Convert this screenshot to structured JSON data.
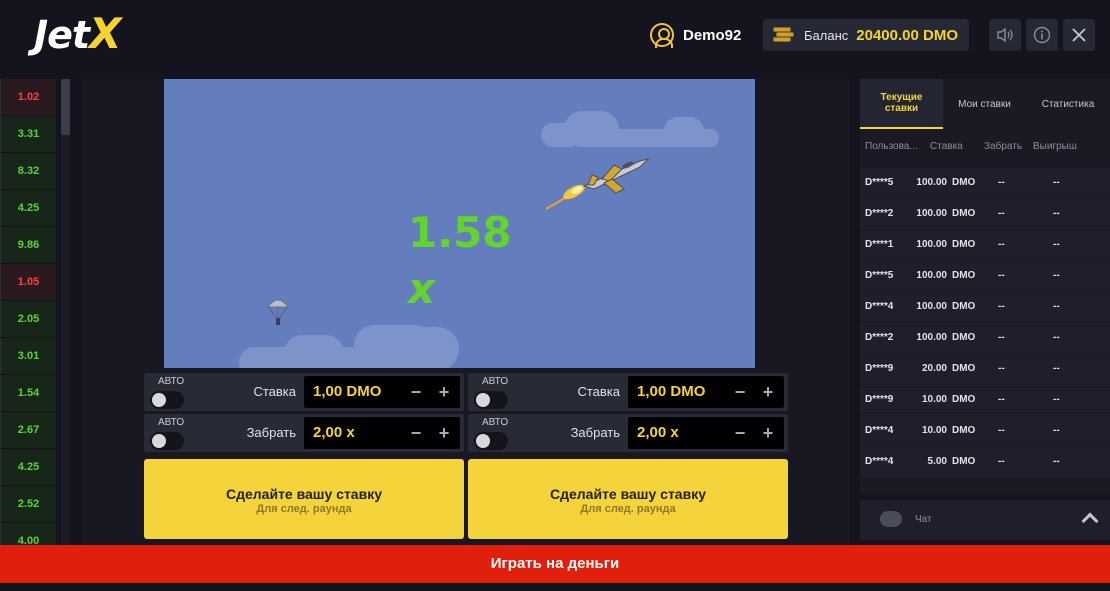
{
  "header": {
    "logo_jet": "Jet",
    "logo_x": "X",
    "username": "Demo92",
    "balance_label": "Баланс",
    "balance_value": "20400.00 DMO"
  },
  "history": [
    {
      "value": "1.02",
      "level": "lo"
    },
    {
      "value": "3.31",
      "level": "hi"
    },
    {
      "value": "8.32",
      "level": "hi"
    },
    {
      "value": "4.25",
      "level": "hi"
    },
    {
      "value": "9.86",
      "level": "hi"
    },
    {
      "value": "1.05",
      "level": "lo"
    },
    {
      "value": "2.05",
      "level": "hi"
    },
    {
      "value": "3.01",
      "level": "hi"
    },
    {
      "value": "1.54",
      "level": "hi"
    },
    {
      "value": "2.67",
      "level": "hi"
    },
    {
      "value": "4.25",
      "level": "hi"
    },
    {
      "value": "2.52",
      "level": "hi"
    },
    {
      "value": "4.00",
      "level": "hi"
    }
  ],
  "game": {
    "multiplier": "1.58",
    "multiplier_suffix": "x"
  },
  "panels": [
    {
      "auto_label_1": "АВТО",
      "stake_label": "Ставка",
      "stake_value": "1,00 DMO",
      "auto_label_2": "АВТО",
      "cashout_label": "Забрать",
      "cashout_value": "2,00 x",
      "button_main": "Сделайте вашу ставку",
      "button_sub": "Для след. раунда"
    },
    {
      "auto_label_1": "АВТО",
      "stake_label": "Ставка",
      "stake_value": "1,00 DMO",
      "auto_label_2": "АВТО",
      "cashout_label": "Забрать",
      "cashout_value": "2,00 x",
      "button_main": "Сделайте вашу ставку",
      "button_sub": "Для след. раунда"
    }
  ],
  "stepper": {
    "minus": "−",
    "plus": "+"
  },
  "right_panel": {
    "tabs": [
      "Текущие ставки",
      "Мои ставки",
      "Статистика"
    ],
    "columns": [
      "Пользова...",
      "Ставка",
      "Забрать",
      "Выигрыш"
    ],
    "rows": [
      {
        "user": "D****5",
        "stake": "100.00",
        "cur": "DMO",
        "cashout": "--",
        "win": "--"
      },
      {
        "user": "D****2",
        "stake": "100.00",
        "cur": "DMO",
        "cashout": "--",
        "win": "--"
      },
      {
        "user": "D****1",
        "stake": "100.00",
        "cur": "DMO",
        "cashout": "--",
        "win": "--"
      },
      {
        "user": "D****5",
        "stake": "100.00",
        "cur": "DMO",
        "cashout": "--",
        "win": "--"
      },
      {
        "user": "D****4",
        "stake": "100.00",
        "cur": "DMO",
        "cashout": "--",
        "win": "--"
      },
      {
        "user": "D****2",
        "stake": "100.00",
        "cur": "DMO",
        "cashout": "--",
        "win": "--"
      },
      {
        "user": "D****9",
        "stake": "20.00",
        "cur": "DMO",
        "cashout": "--",
        "win": "--"
      },
      {
        "user": "D****9",
        "stake": "10.00",
        "cur": "DMO",
        "cashout": "--",
        "win": "--"
      },
      {
        "user": "D****4",
        "stake": "10.00",
        "cur": "DMO",
        "cashout": "--",
        "win": "--"
      },
      {
        "user": "D****4",
        "stake": "5.00",
        "cur": "DMO",
        "cashout": "--",
        "win": "--"
      }
    ],
    "chat_label": "Чат"
  },
  "play_button": "Играть на деньги",
  "icons": {
    "sound": "speaker-icon",
    "info": "info-icon",
    "close": "close-icon"
  },
  "colors": {
    "accent": "#f5d52c",
    "multiplier": "#63d32e",
    "loss": "#ff3e3e",
    "win": "#5bd338",
    "play_bar": "#e01f0c",
    "sky": "#647ebd"
  }
}
